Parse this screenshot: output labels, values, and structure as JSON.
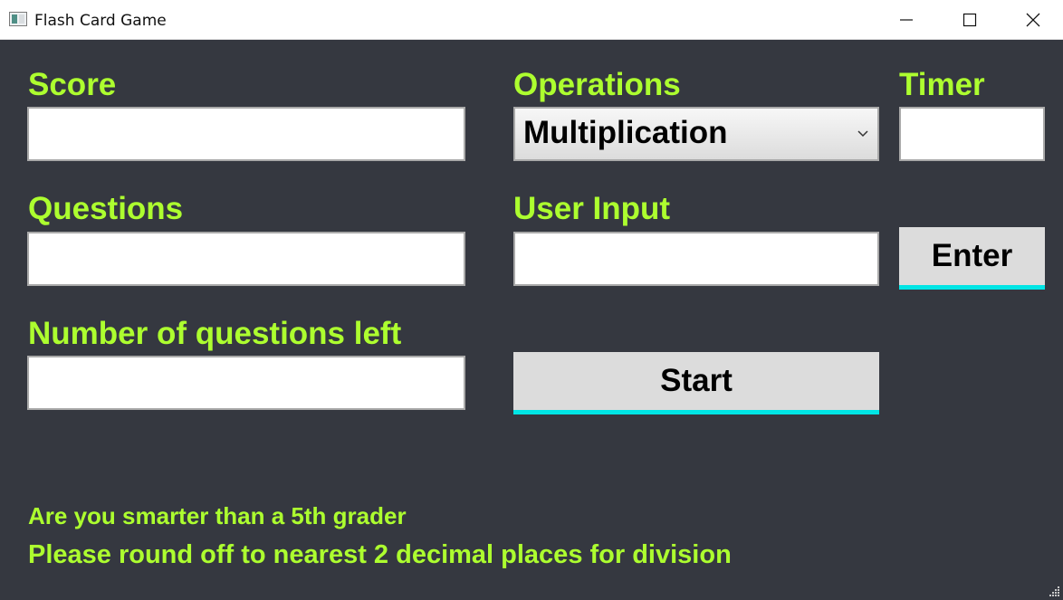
{
  "window": {
    "title": "Flash Card Game",
    "controls": [
      "minimize",
      "maximize",
      "close"
    ]
  },
  "colors": {
    "background": "#353840",
    "label": "#adff2f",
    "button_accent": "#00e5e5"
  },
  "labels": {
    "score": "Score",
    "operations": "Operations",
    "timer": "Timer",
    "questions": "Questions",
    "user_input": "User Input",
    "questions_left": "Number of questions left"
  },
  "fields": {
    "score": "",
    "timer": "",
    "questions": "",
    "user_input": "",
    "questions_left": ""
  },
  "operations_select": {
    "selected": "Multiplication"
  },
  "buttons": {
    "enter": "Enter",
    "start": "Start"
  },
  "notes": {
    "line1": "Are you smarter than a 5th grader",
    "line2": "Please round off to nearest 2 decimal places for division"
  }
}
